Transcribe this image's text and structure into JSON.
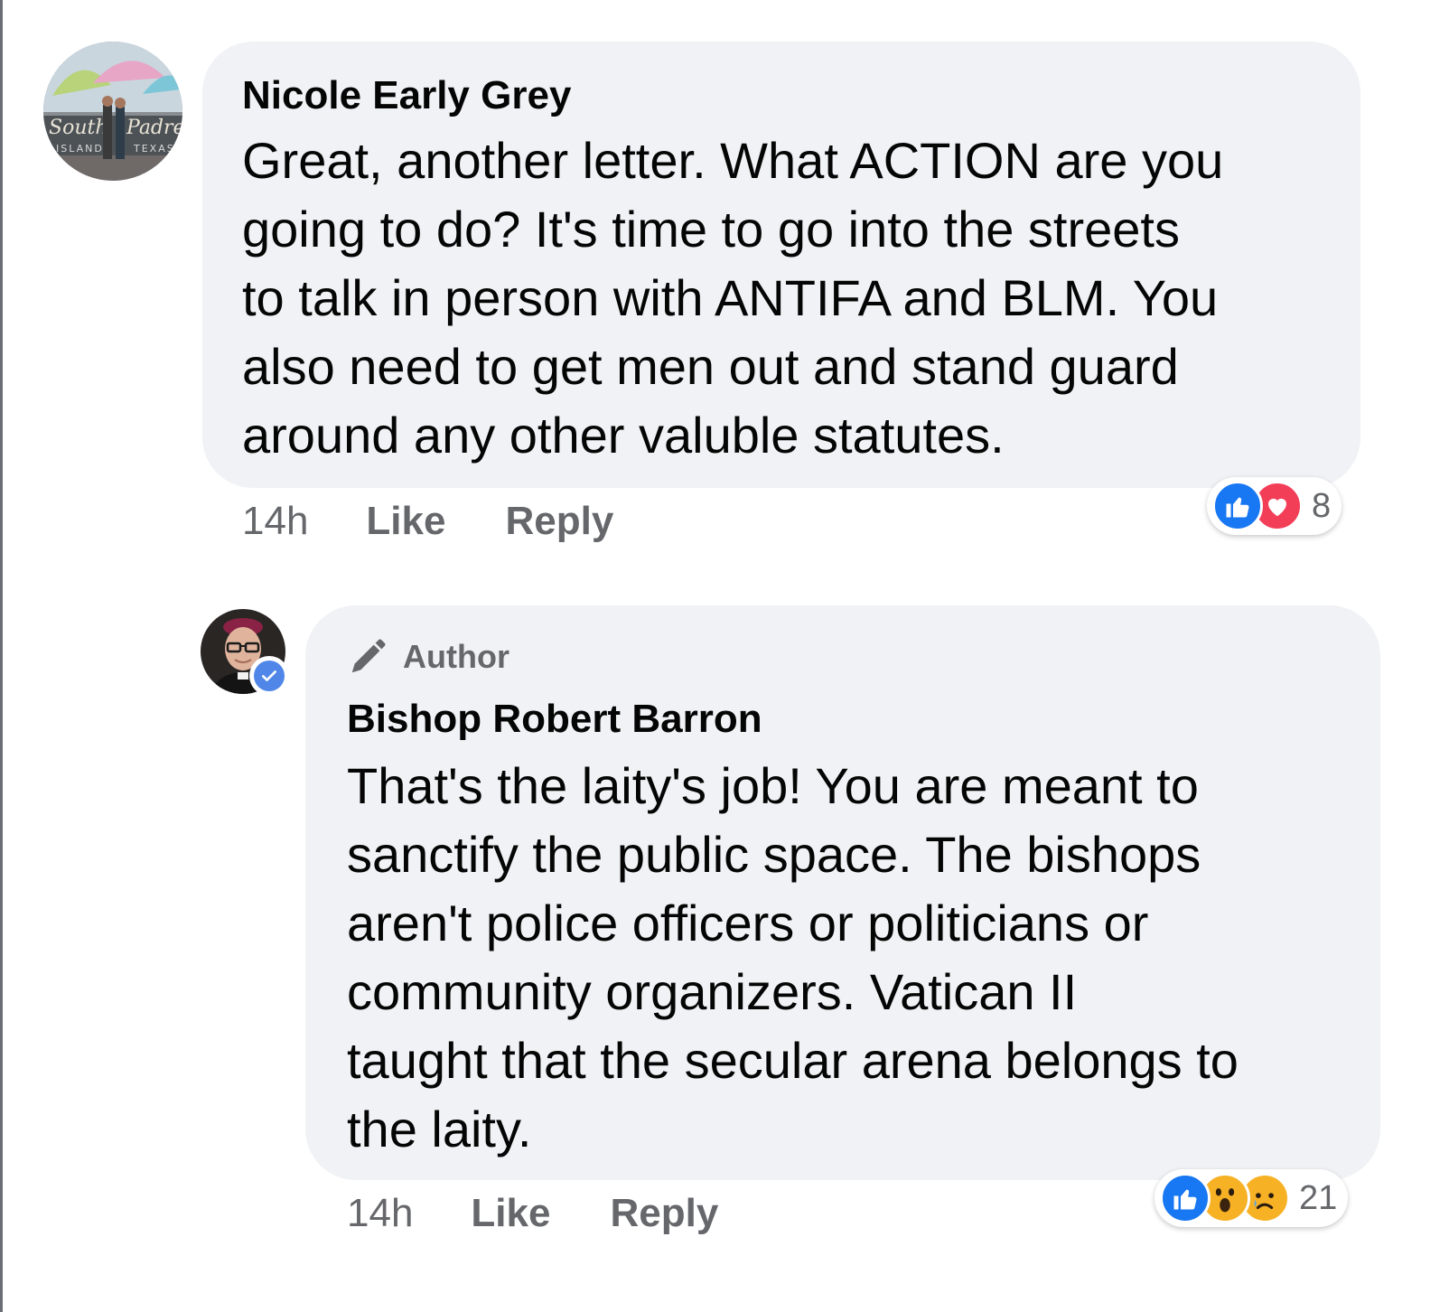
{
  "comments": [
    {
      "author": "Nicole Early Grey",
      "avatar_icon": "beach-sign-avatar",
      "avatar_sign_words": [
        "South",
        "Padre",
        "ISLAND",
        "TEXAS"
      ],
      "text": "Great, another letter. What ACTION are you\ngoing to do? It's time to go into the streets\nto talk in person with ANTIFA and BLM. You\nalso need to get men out and stand guard\naround any other valuble statutes.",
      "time": "14h",
      "like_label": "Like",
      "reply_label": "Reply",
      "reactions": {
        "icons": [
          "like-icon",
          "love-icon"
        ],
        "count": "8"
      }
    },
    {
      "author_badge": "Author",
      "author_badge_icon": "pen-icon",
      "author": "Bishop Robert Barron",
      "avatar_icon": "bishop-portrait-avatar",
      "verified": true,
      "text": "That's the laity's job!  You are meant to\nsanctify the public space.  The bishops\naren't police officers or politicians or\ncommunity organizers.  Vatican II\ntaught that the secular arena belongs to\nthe laity.",
      "time": "14h",
      "like_label": "Like",
      "reply_label": "Reply",
      "reactions": {
        "icons": [
          "like-icon",
          "wow-icon",
          "sad-icon"
        ],
        "count": "21"
      }
    }
  ],
  "colors": {
    "bubble": "#f0f2f5",
    "secondary_text": "#65676b",
    "like_blue": "#1877f2",
    "love_red": "#f33e58",
    "emoji_yellow": "#f7b125"
  }
}
